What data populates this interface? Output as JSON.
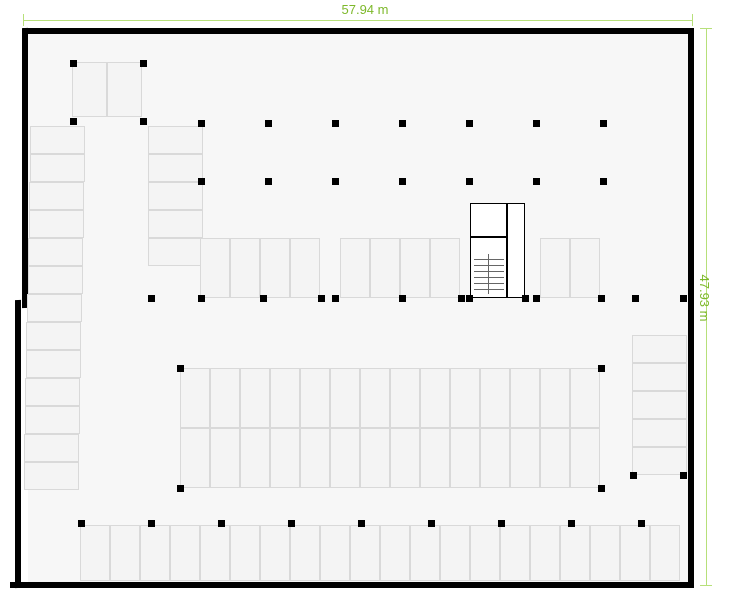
{
  "dimensions": {
    "width_label": "57.94 m",
    "height_label": "47.93 m"
  },
  "plan": {
    "floor_bg": "#f7f7f7",
    "wall_color": "#000000",
    "stall_fill": "#f4f4f4",
    "stall_border": "#d9d9d9",
    "dim_color": "#7db82a",
    "column_size": 7
  }
}
